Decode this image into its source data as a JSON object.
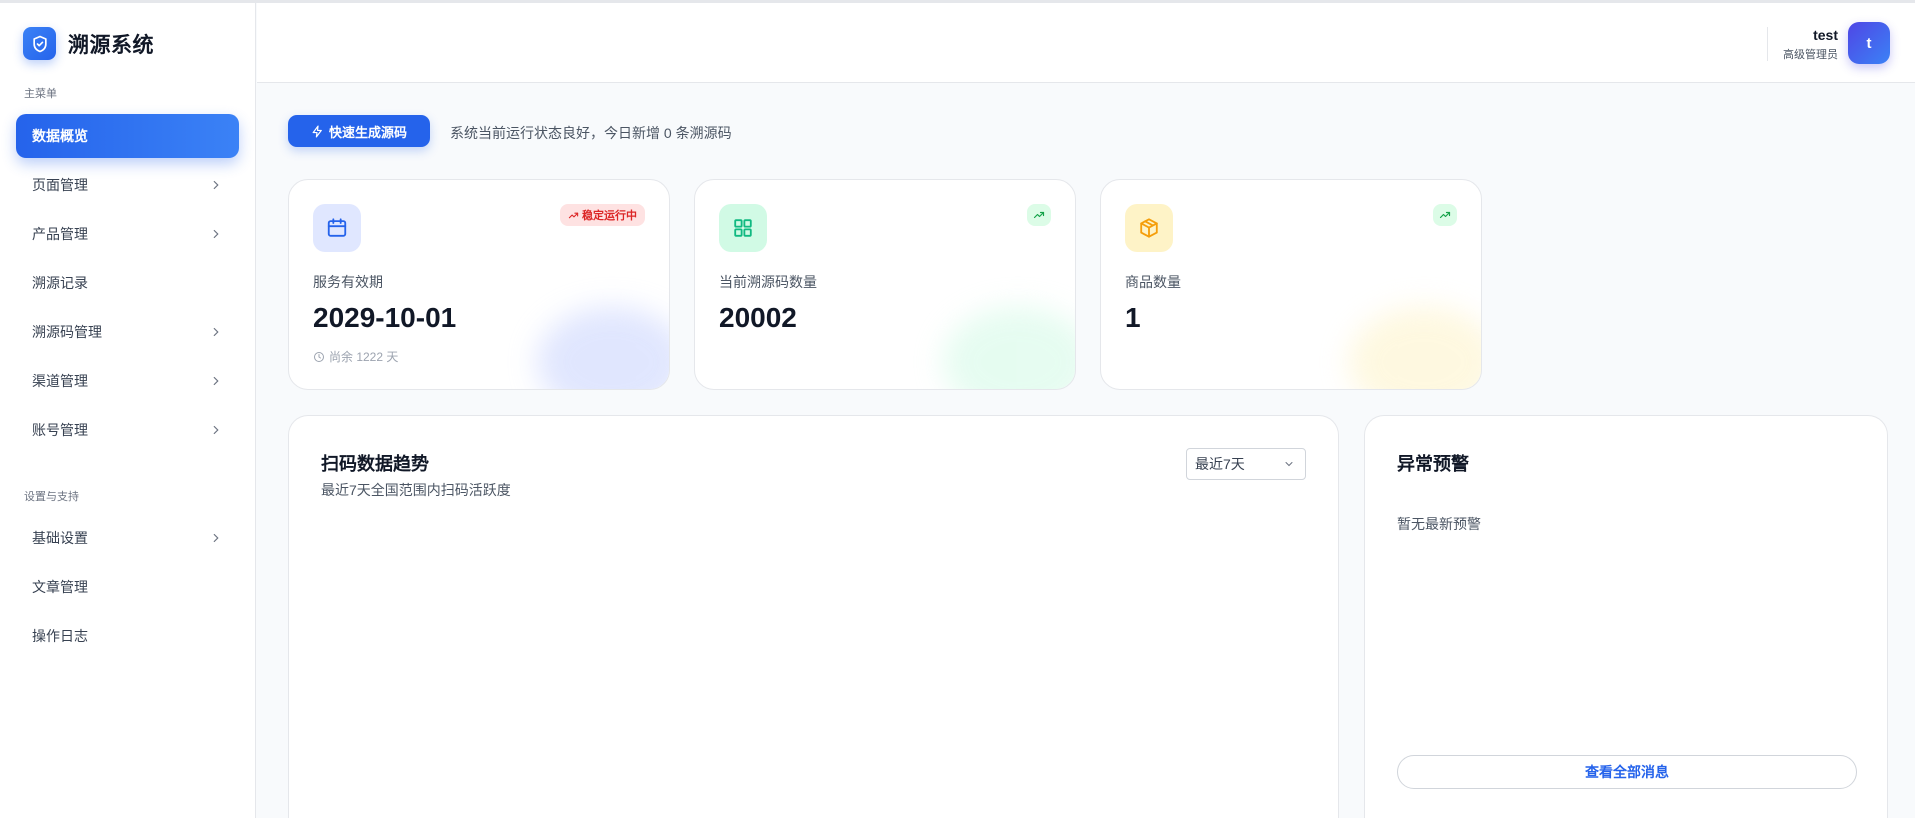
{
  "brand": {
    "title": "溯源系统",
    "icon": "shield-check-icon"
  },
  "sidebar": {
    "sections": [
      {
        "label": "主菜单"
      },
      {
        "label": "设置与支持"
      }
    ],
    "items": [
      {
        "label": "数据概览",
        "active": true,
        "has_children": false
      },
      {
        "label": "页面管理",
        "has_children": true
      },
      {
        "label": "产品管理",
        "has_children": true
      },
      {
        "label": "溯源记录",
        "has_children": false
      },
      {
        "label": "溯源码管理",
        "has_children": true
      },
      {
        "label": "渠道管理",
        "has_children": true
      },
      {
        "label": "账号管理",
        "has_children": true
      },
      {
        "label": "基础设置",
        "has_children": true
      },
      {
        "label": "文章管理",
        "has_children": false
      },
      {
        "label": "操作日志",
        "has_children": false
      }
    ]
  },
  "header": {
    "user": {
      "name": "test",
      "role": "高级管理员",
      "avatar_letter": "t"
    }
  },
  "quickbar": {
    "button_label": "快速生成源码",
    "status": "系统当前运行状态良好，今日新增 0 条溯源码"
  },
  "stats": [
    {
      "label": "服务有效期",
      "value": "2029-10-01",
      "sub": "尚余 1222 天",
      "badge": "稳定运行中",
      "icon": "calendar-icon",
      "color": "#2563eb"
    },
    {
      "label": "当前溯源码数量",
      "value": "20002",
      "icon": "grid-icon",
      "color": "#10b981"
    },
    {
      "label": "商品数量",
      "value": "1",
      "icon": "package-icon",
      "color": "#f59e0b"
    }
  ],
  "trend": {
    "title": "扫码数据趋势",
    "subtitle": "最近7天全国范围内扫码活跃度",
    "range_selected": "最近7天"
  },
  "alerts": {
    "title": "异常预警",
    "empty": "暂无最新预警",
    "view_all": "查看全部消息"
  },
  "colors": {
    "primary": "#2563eb",
    "success": "#10b981",
    "warning": "#f59e0b",
    "danger": "#dc2626"
  }
}
